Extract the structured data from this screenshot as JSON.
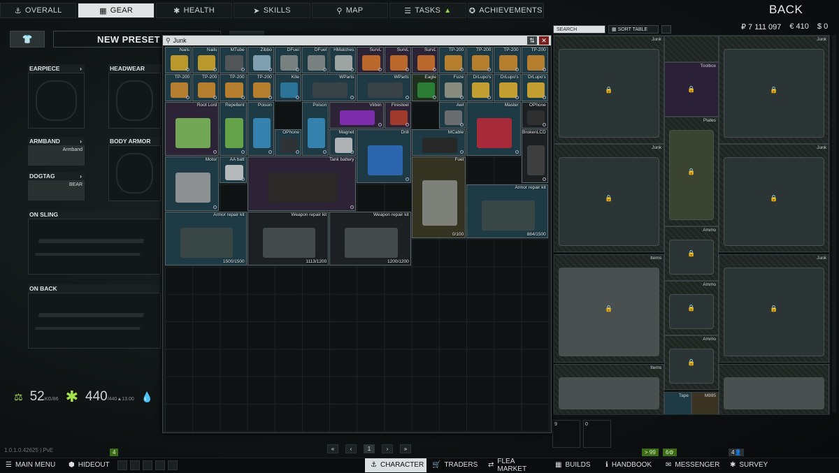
{
  "topnav": [
    {
      "icon": "⚓",
      "label": "OVERALL",
      "active": false
    },
    {
      "icon": "▦",
      "label": "GEAR",
      "active": true
    },
    {
      "icon": "✱",
      "label": "HEALTH",
      "active": false
    },
    {
      "icon": "➤",
      "label": "SKILLS",
      "active": false
    },
    {
      "icon": "⚲",
      "label": "MAP",
      "active": false
    },
    {
      "icon": "☰",
      "label": "TASKS",
      "active": false
    },
    {
      "icon": "✪",
      "label": "ACHIEVEMENTS",
      "active": false
    }
  ],
  "back_label": "BACK",
  "money": {
    "rubles": "₽ 7 111 097",
    "euros": "€ 410",
    "dollars": "$ 0"
  },
  "preset": {
    "title": "NEW PRESET"
  },
  "gear_slots": {
    "earpiece": "EARPIECE",
    "headwear": "HEADWEAR",
    "armband": "ARMBAND",
    "armband_item": "Armband",
    "body_armor": "BODY ARMOR",
    "dogtag": "DOGTAG",
    "dogtag_item": "BEAR",
    "on_sling": "ON SLING",
    "on_back": "ON BACK"
  },
  "stats": {
    "weight": "52",
    "weight_unit": "KG",
    "weight_max": "/86",
    "health": "440",
    "health_max": "/440",
    "health_regen": "▲13.00"
  },
  "search_modal": {
    "query": "Junk",
    "items": [
      {
        "name": "Nails"
      },
      {
        "name": "Nails"
      },
      {
        "name": "MTube"
      },
      {
        "name": "Zibbo"
      },
      {
        "name": "DFuel"
      },
      {
        "name": "DFuel"
      },
      {
        "name": "HMatches"
      },
      {
        "name": "SurvL"
      },
      {
        "name": "SurvL"
      },
      {
        "name": "SurvL"
      },
      {
        "name": "TP-200"
      },
      {
        "name": "TP-200"
      },
      {
        "name": "TP-200"
      },
      {
        "name": "TP-200"
      },
      {
        "name": "TP-200"
      },
      {
        "name": "TP-200"
      },
      {
        "name": "TP-200"
      },
      {
        "name": "TP-200"
      },
      {
        "name": "Kite"
      },
      {
        "name": "WParts"
      },
      {
        "name": "WParts"
      },
      {
        "name": "Eagle"
      },
      {
        "name": "Fuze"
      },
      {
        "name": "DrLupo's"
      },
      {
        "name": "DrLupo's"
      },
      {
        "name": "DrLupo's"
      },
      {
        "name": "Root Lord"
      },
      {
        "name": "Repellent"
      },
      {
        "name": "Poison"
      },
      {
        "name": "Poison"
      },
      {
        "name": "Viibiin"
      },
      {
        "name": "Firesteel"
      },
      {
        "name": "Awl"
      },
      {
        "name": "Master"
      },
      {
        "name": "OPhone"
      },
      {
        "name": "OPhone"
      },
      {
        "name": "Magnet"
      },
      {
        "name": "Drill"
      },
      {
        "name": "MCable"
      },
      {
        "name": "BrokenLCD"
      },
      {
        "name": "Motor"
      },
      {
        "name": "AA batt"
      },
      {
        "name": "Tank battery"
      },
      {
        "name": "Fuel",
        "durability": "0/100"
      },
      {
        "name": "Armor repair kit",
        "durability": "884/1500"
      },
      {
        "name": "Armor repair kit",
        "durability": "1500/1500"
      },
      {
        "name": "Weapon repair kit",
        "durability": "1113/1200"
      },
      {
        "name": "Weapon repair kit",
        "durability": "1200/1200"
      }
    ]
  },
  "pager": {
    "first": "«",
    "prev": "‹",
    "page": "1",
    "next": "›",
    "last": "»"
  },
  "stash": {
    "search_label": "SEARCH",
    "sort_label": "SORT TABLE",
    "containers": [
      {
        "name": "Junk"
      },
      {
        "name": ""
      },
      {
        "name": "Junk"
      },
      {
        "name": "Toolbox"
      },
      {
        "name": "Junk"
      },
      {
        "name": "Plates"
      },
      {
        "name": "Junk"
      },
      {
        "name": "Ammo"
      },
      {
        "name": "Items"
      },
      {
        "name": "Ammo"
      },
      {
        "name": "Junk"
      },
      {
        "name": "Items"
      },
      {
        "name": "Ammo"
      },
      {
        "name": "Tape"
      },
      {
        "name": "M995"
      }
    ]
  },
  "quick_slots": [
    "9",
    "0"
  ],
  "version": "1.0.1.0.42625 | PvE",
  "badges": {
    "left": "4",
    "level": "> 99",
    "skill": "6⚙",
    "friends": "4👤"
  },
  "bottombar": [
    {
      "icon": "☰",
      "label": "MAIN MENU",
      "active": false
    },
    {
      "icon": "⬢",
      "label": "HIDEOUT",
      "active": false
    },
    {
      "icon": "⚓",
      "label": "CHARACTER",
      "active": true
    },
    {
      "icon": "🛒",
      "label": "TRADERS",
      "active": false
    },
    {
      "icon": "⇄",
      "label": "FLEA MARKET",
      "active": false
    },
    {
      "icon": "▦",
      "label": "BUILDS",
      "active": false
    },
    {
      "icon": "ℹ",
      "label": "HANDBOOK",
      "active": false
    },
    {
      "icon": "✉",
      "label": "MESSENGER",
      "active": false
    },
    {
      "icon": "✱",
      "label": "SURVEY",
      "active": false
    }
  ]
}
